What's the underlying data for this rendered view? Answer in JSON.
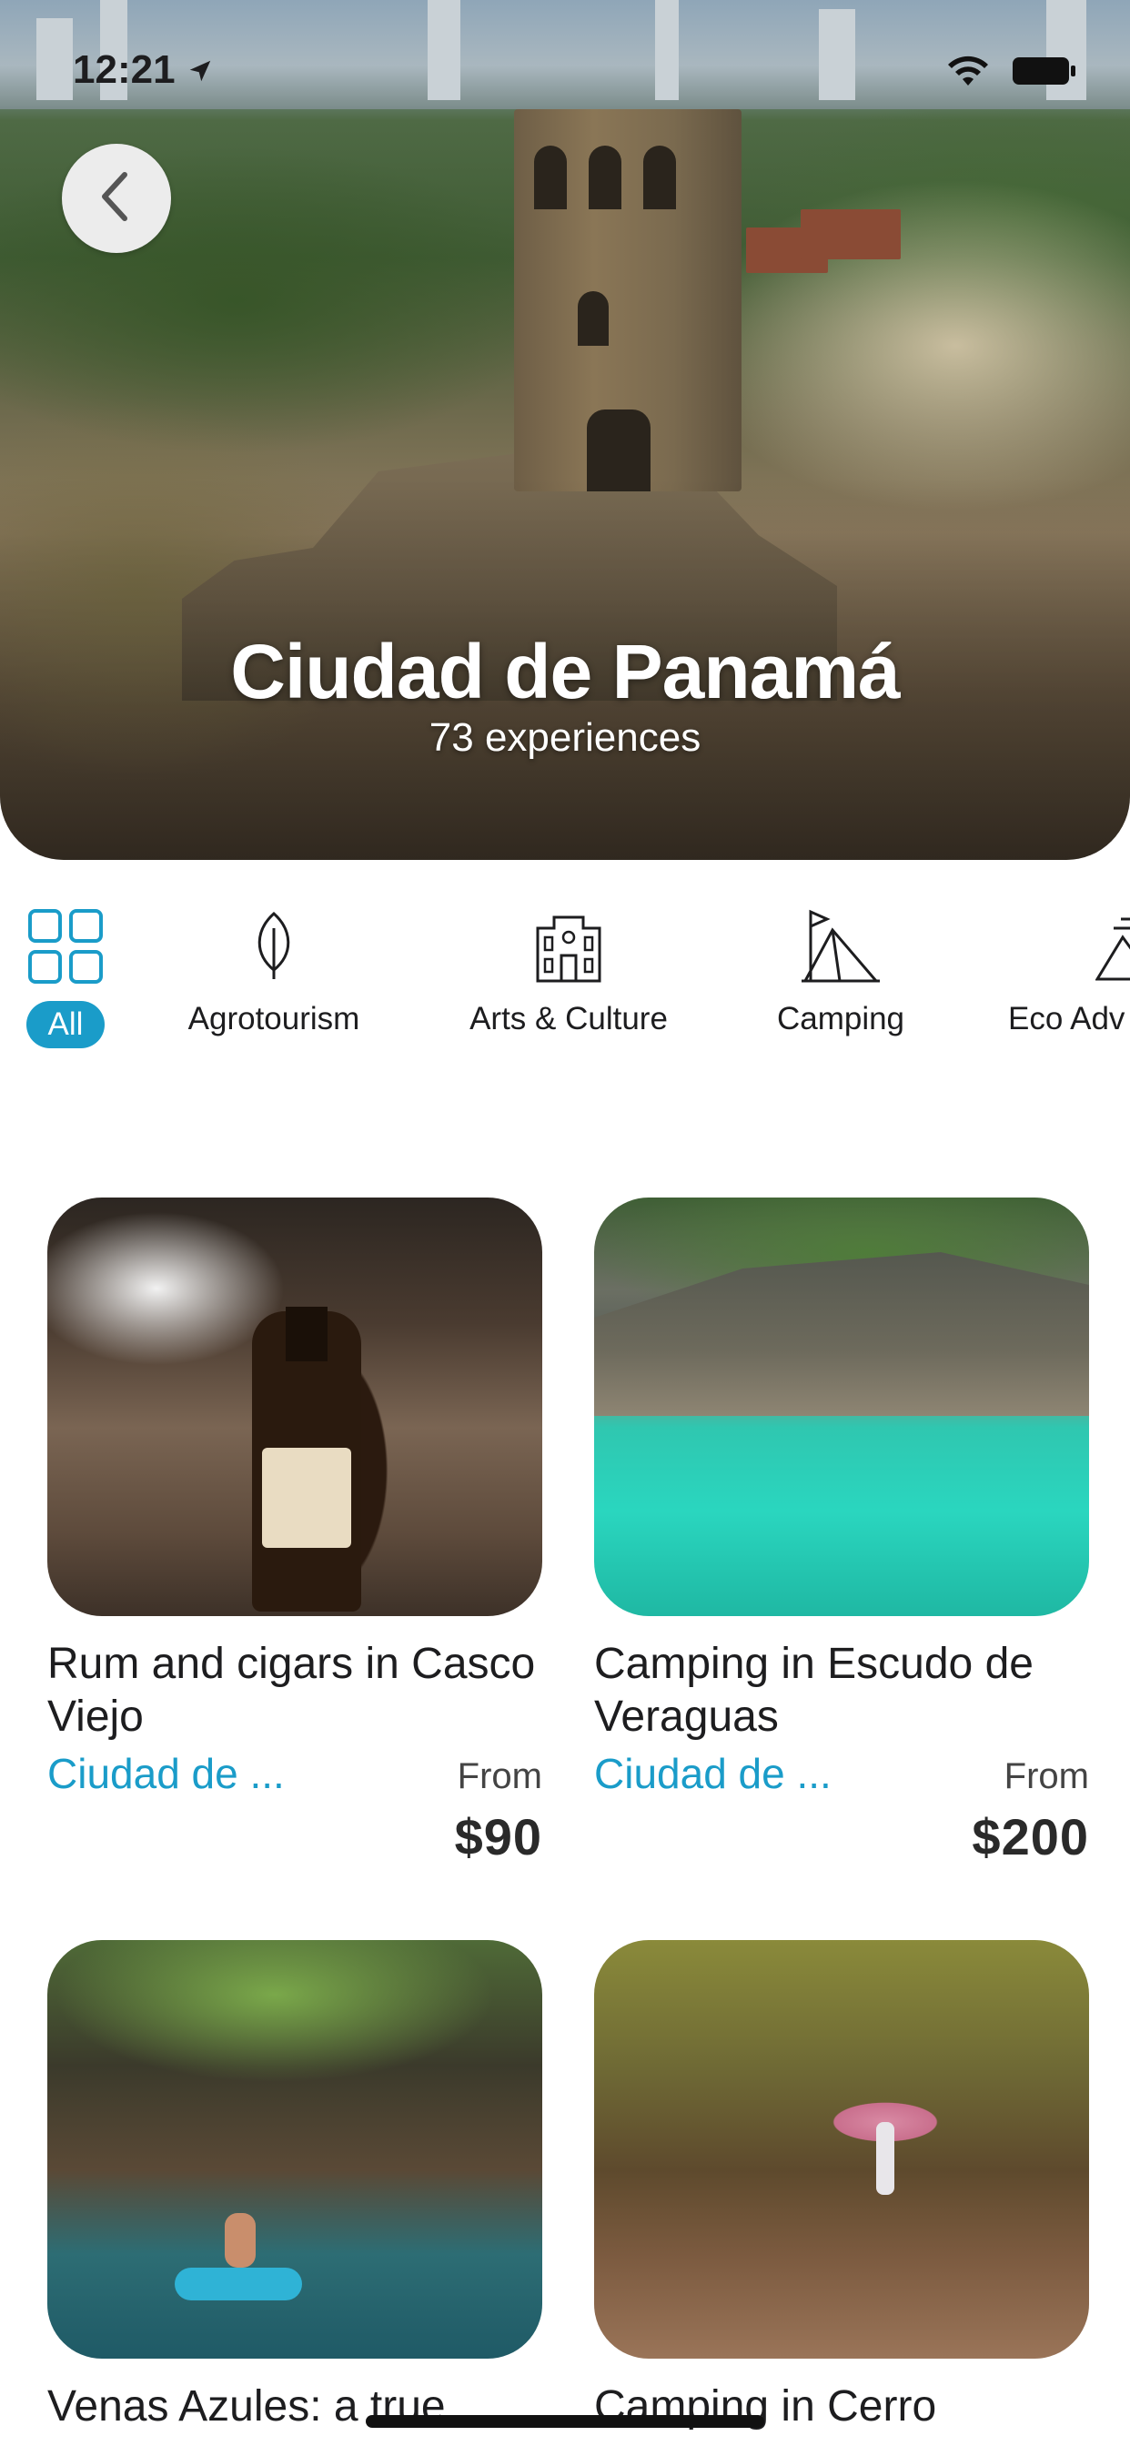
{
  "status_bar": {
    "time": "12:21"
  },
  "hero": {
    "title": "Ciudad de Panamá",
    "subtitle": "73 experiences"
  },
  "categories": [
    {
      "label": "All",
      "icon": "grid-icon",
      "active": true
    },
    {
      "label": "Agrotourism",
      "icon": "leaf-icon",
      "active": false
    },
    {
      "label": "Arts & Culture",
      "icon": "building-icon",
      "active": false
    },
    {
      "label": "Camping",
      "icon": "tent-icon",
      "active": false
    },
    {
      "label": "Eco Adv",
      "icon": "mountain-icon",
      "active": false
    }
  ],
  "experiences": [
    {
      "title": "Rum and cigars in Casco Viejo",
      "city": "Ciudad de ...",
      "from_label": "From",
      "price": "$90"
    },
    {
      "title": "Camping in Escudo de Veraguas",
      "city": "Ciudad de ...",
      "from_label": "From",
      "price": "$200"
    },
    {
      "title": "Venas Azules: a true",
      "city": "",
      "from_label": "",
      "price": ""
    },
    {
      "title": "Camping in Cerro",
      "city": "",
      "from_label": "",
      "price": ""
    }
  ],
  "colors": {
    "accent": "#1a9cc9",
    "text": "#1d1d1f",
    "background": "#ffffff"
  }
}
